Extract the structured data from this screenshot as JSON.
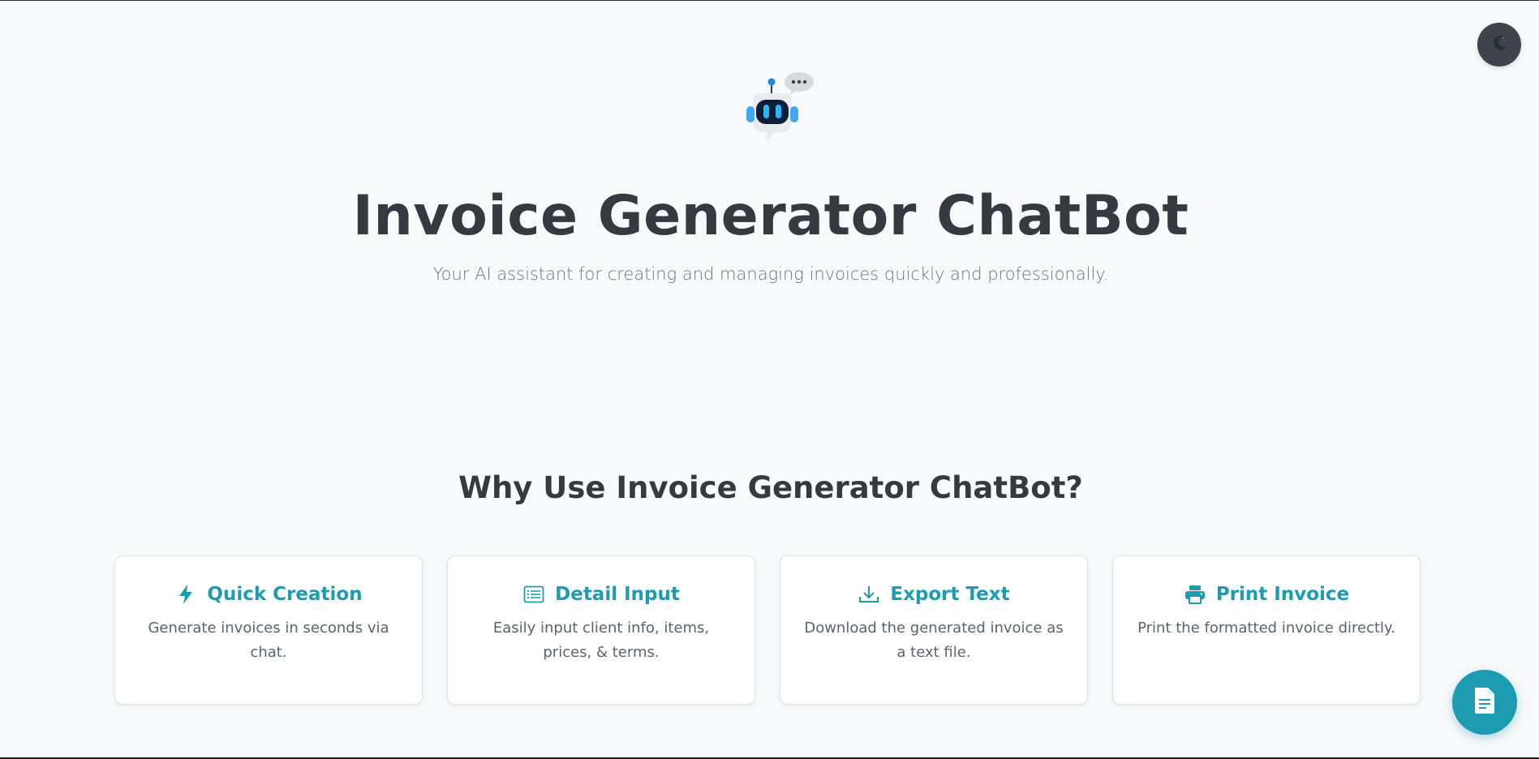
{
  "header": {
    "theme_toggle_icon": "moon-icon"
  },
  "hero": {
    "logo_icon": "robot-chat-icon",
    "title": "Invoice Generator ChatBot",
    "subtitle": "Your AI assistant for creating and managing invoices quickly and professionally."
  },
  "features": {
    "heading": "Why Use Invoice Generator ChatBot?",
    "items": [
      {
        "icon": "lightning-bolt-icon",
        "title": "Quick Creation",
        "description": "Generate invoices in seconds via chat."
      },
      {
        "icon": "list-details-icon",
        "title": "Detail Input",
        "description": "Easily input client info, items, prices, & terms."
      },
      {
        "icon": "download-icon",
        "title": "Export Text",
        "description": "Download the generated invoice as a text file."
      },
      {
        "icon": "printer-icon",
        "title": "Print Invoice",
        "description": "Print the formatted invoice directly."
      }
    ]
  },
  "fab": {
    "icon": "document-icon"
  },
  "colors": {
    "accent": "#1d9bb0",
    "background": "#f8f9fa",
    "title_text": "#343a40",
    "muted_text": "#6c757d",
    "toggle_bg": "#3e444b"
  }
}
